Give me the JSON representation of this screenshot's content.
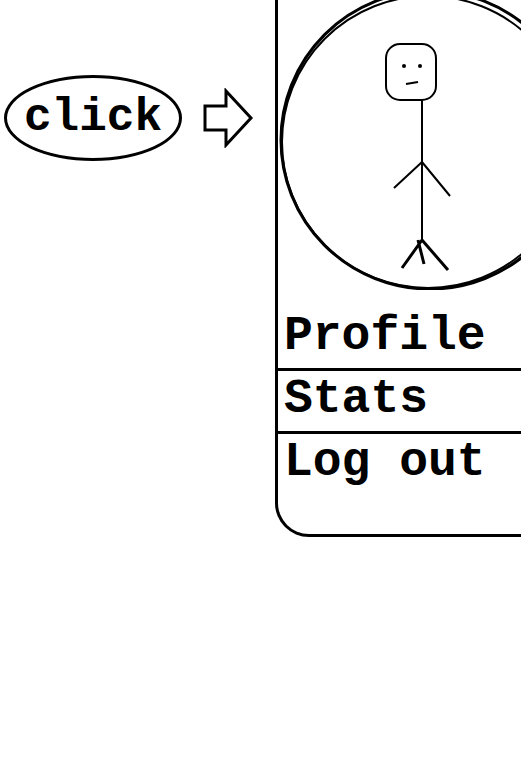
{
  "annotation": {
    "label": "click"
  },
  "menu": {
    "items": [
      {
        "label": "Profile"
      },
      {
        "label": "Stats"
      },
      {
        "label": "Log out"
      }
    ]
  }
}
